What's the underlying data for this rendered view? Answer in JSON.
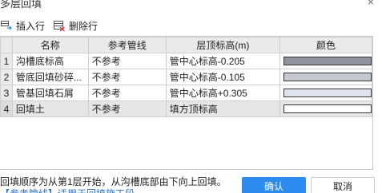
{
  "dialog": {
    "title": "多层回填",
    "close_glyph": "×"
  },
  "toolbar": {
    "insert_label": "插入行",
    "delete_label": "删除行"
  },
  "table": {
    "headers": [
      "名称",
      "参考管线",
      "层顶标高(m)",
      "颜色"
    ],
    "rows": [
      {
        "no": "1",
        "name": "沟槽底标高",
        "ref": "不参考",
        "top": "管中心标高-0.205",
        "color": "#8e939d"
      },
      {
        "no": "2",
        "name": "管底回填砂碎...",
        "ref": "不参考",
        "top": "管中心标高-0.105",
        "color": "#c3c8d1"
      },
      {
        "no": "3",
        "name": "管基回填石屑",
        "ref": "不参考",
        "top": "管中心标高+0.305",
        "color": "#dfe3ee"
      },
      {
        "no": "4",
        "name": "回填土",
        "ref": "不参考",
        "top": "填方顶标高",
        "color": "#ffffff"
      }
    ]
  },
  "footer": {
    "note": "回填顺序为从第1层开始，从沟槽底部由下向上回填。",
    "note2": "【参考管线】适用于回填施工段",
    "ok_label": "确认",
    "cancel_label": "取消"
  },
  "colors": {
    "accent": "#2d8cf0"
  }
}
